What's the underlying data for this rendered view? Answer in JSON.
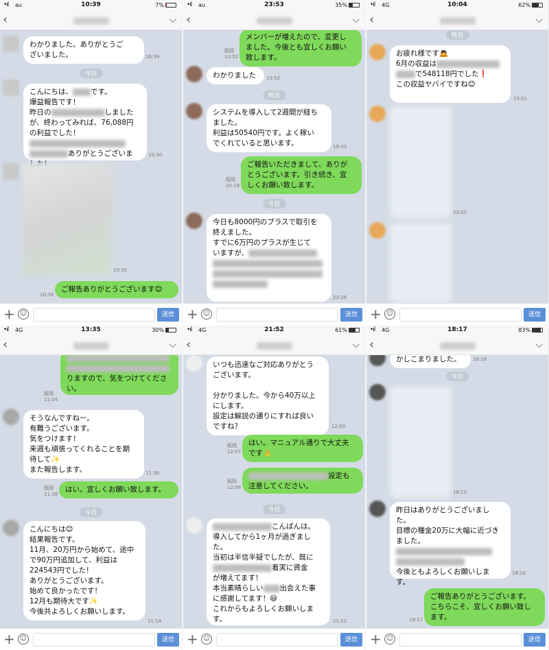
{
  "send_label": "送信",
  "panels": [
    {
      "status": {
        "signal": "•ıl",
        "carrier": "au",
        "time": "10:39",
        "battery": "7%",
        "battery_fraction": 0.07
      },
      "messages": {
        "m1": "わかりました。ありがとうご\nざいました。",
        "m1_ts": "16:39",
        "day1": "今日",
        "m2a": "こんにちは、",
        "m2b": "です。\n爆益報告です！\n昨日の",
        "m2c": "しました\nが、終わってみれば、76,088円\nの利益でした！",
        "m2d": "ありがとうございま\nした！",
        "m2_ts": "10:30",
        "img_ts": "10:30",
        "m3": "ご報告ありがとうございます😊",
        "m3_ts": "10:39"
      }
    },
    {
      "status": {
        "signal": "•ıl",
        "carrier": "au",
        "time": "23:53",
        "battery": "35%",
        "battery_fraction": 0.35
      },
      "messages": {
        "m0": "メンバーが増えたので、変更し\nました。今後とも宜しくお願い\n致します。",
        "m0_ts_a": "既読",
        "m0_ts": "13:52",
        "m1": "わかりました",
        "m1_ts": "13:52",
        "day1": "昨日",
        "m2": "システムを導入して2週間が経ち\nました。\n利益は50540円です。よく稼い\nでくれていると思います。",
        "m2_ts": "19:43",
        "m3": "ご報告いただきまして、ありが\nとうございます。引き続き、宜\nしくお願い致します。",
        "m3_ts_a": "既読",
        "m3_ts": "20:18",
        "day2": "今日",
        "m4": "今日も8000円のプラスで取引を\n終えました。\nすでに6万円のプラスが生じて\nいますが、",
        "m4_ts": "23:26"
      }
    },
    {
      "status": {
        "signal": "•ıl",
        "carrier": "4G",
        "time": "10:04",
        "battery": "62%",
        "battery_fraction": 0.62
      },
      "messages": {
        "day1": "昨日",
        "m1a": "お疲れ様です🙇",
        "m1b": "6月の収益は",
        "m1c": "で548118円でした❗",
        "m1d": "この収益ヤバイですね😊",
        "m1_ts": "23:01",
        "img1_ts": "23:02"
      }
    },
    {
      "status": {
        "signal": "•ıl",
        "carrier": "4G",
        "time": "13:35",
        "battery": "30%",
        "battery_fraction": 0.3
      },
      "messages": {
        "m0": "りますので、気をつけてくださ\nい。",
        "m0_ts_a": "既読",
        "m0_ts": "11:04",
        "m1": "そうなんですねー。\n有難うございます。\n気をつけます！\n来週も頑張ってくれることを期\n待して✨\nまた報告します。",
        "m1_ts": "11:38",
        "m2": "はい。宜しくお願い致します。",
        "m2_ts_a": "既読",
        "m2_ts": "11:38",
        "day1": "今日",
        "m3": "こんにちは😊\n結果報告です。\n11月、20万円から始めて、途中\nで90万円追加して、利益は\n224543円でした！\nありがとうございます。\n始めて良かったです！\n12月も期待大です✨\n今後共よろしくお願いします。",
        "m3_ts": "11:14"
      }
    },
    {
      "status": {
        "signal": "•ıl",
        "carrier": "4G",
        "time": "21:52",
        "battery": "61%",
        "battery_fraction": 0.61
      },
      "messages": {
        "m1": "いつも迅速なご対応ありがとう\nございます。\n\n分かりました。今から40万以上\nにします。\n設定は解説の通りにすれば良い\nですね？",
        "m1_ts": "12:00",
        "m2": "はい。マニュアル通りで大丈夫\nです👌",
        "m2_ts_a": "既読",
        "m2_ts": "12:07",
        "m3a": "設定も",
        "m3b": "注意してください。",
        "m3_ts_a": "既読",
        "m3_ts": "12:08",
        "day1": "今日",
        "m4a": "こんばんは。",
        "m4b": "導入してから1ヶ月が過ぎまし\nた。\n当初は半信半疑でしたが、既に",
        "m4c": "着実に資金\nが増えてます！\n本当素晴らしい",
        "m4d": "出会えた事\nに感謝してます！😃\nこれからもよろしくお願いしま\nす。",
        "m4_ts": "21:51"
      }
    },
    {
      "status": {
        "signal": "•ıl",
        "carrier": "4G",
        "time": "18:17",
        "battery": "83%",
        "battery_fraction": 0.83
      },
      "messages": {
        "m0": "かしこまりました。",
        "m0_ts": "18:16",
        "day1": "今日",
        "img_ts": "18:15",
        "m1a": "昨日はありがとうございまし\nた。\n目標の種金20万に大幅に近づき\nました。",
        "m1b": "今後ともよろしくお願いしま\nす。",
        "m1_ts": "18:16",
        "m2": "ご報告ありがとうございます。\nこちらこそ、宜しくお願い致し\nます。",
        "m2_ts": "18:17"
      }
    }
  ]
}
